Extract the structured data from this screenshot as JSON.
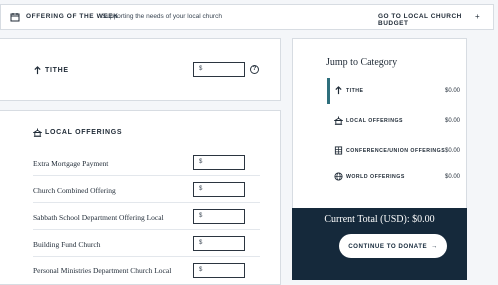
{
  "banner": {
    "title": "OFFERING OF THE WEEK",
    "subtitle": "Supporting the needs of your local church",
    "link_label": "GO TO LOCAL CHURCH BUDGET",
    "link_arrow": "+"
  },
  "tithe": {
    "heading": "TITHE",
    "currency_prefix": "$",
    "info_glyph": "?"
  },
  "local_offerings": {
    "heading": "LOCAL OFFERINGS",
    "rows": [
      {
        "label": "Extra Mortgage Payment",
        "prefix": "$"
      },
      {
        "label": "Church Combined Offering",
        "prefix": "$"
      },
      {
        "label": "Sabbath School Department Offering Local",
        "prefix": "$"
      },
      {
        "label": "Building Fund Church",
        "prefix": "$"
      },
      {
        "label": "Personal Ministries Department Church Local",
        "prefix": "$"
      }
    ]
  },
  "jump": {
    "title": "Jump to Category",
    "categories": [
      {
        "label": "TITHE",
        "amount": "$0.00",
        "icon": "tithe-arrow-icon"
      },
      {
        "label": "LOCAL OFFERINGS",
        "amount": "$0.00",
        "icon": "church-icon"
      },
      {
        "label": "CONFERENCE/UNION OFFERINGS",
        "amount": "$0.00",
        "icon": "building-icon"
      },
      {
        "label": "WORLD OFFERINGS",
        "amount": "$0.00",
        "icon": "globe-icon"
      }
    ],
    "accent_color": "#2e6f7c"
  },
  "total": {
    "text": "Current Total (USD): $0.00",
    "button_label": "CONTINUE TO DONATE",
    "button_arrow": "→",
    "panel_color": "#15293b"
  }
}
